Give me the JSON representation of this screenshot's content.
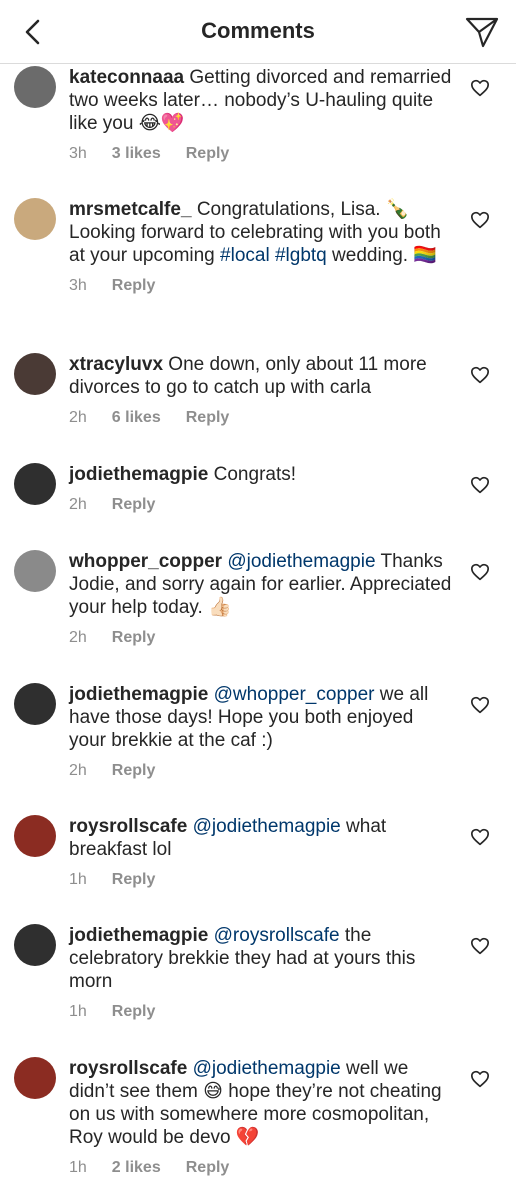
{
  "header": {
    "title": "Comments"
  },
  "colors": {
    "text": "#262626",
    "meta": "#8e8e8e",
    "link": "#00376b",
    "divider": "#dbdbdb"
  },
  "comments": [
    {
      "username": "kateconnaaa",
      "parts": [
        {
          "t": "text",
          "v": "Getting divorced and remarried two weeks later… nobody’s U-hauling quite like you 😂💖"
        }
      ],
      "time": "3h",
      "likes": "3 likes",
      "reply": "Reply",
      "avatar_color": "#6b6b6b"
    },
    {
      "username": "mrsmetcalfe_",
      "parts": [
        {
          "t": "text",
          "v": "Congratulations, Lisa. 🍾 Looking forward to celebrating with you both at your upcoming "
        },
        {
          "t": "tag",
          "v": "#local"
        },
        {
          "t": "text",
          "v": " "
        },
        {
          "t": "tag",
          "v": "#lgbtq"
        },
        {
          "t": "text",
          "v": " wedding. 🏳️‍🌈"
        }
      ],
      "time": "3h",
      "likes": "",
      "reply": "Reply",
      "avatar_color": "#c9a97d"
    },
    {
      "username": "xtracyluvx",
      "parts": [
        {
          "t": "text",
          "v": "One down, only about 11 more divorces to go to catch up with carla"
        }
      ],
      "time": "2h",
      "likes": "6 likes",
      "reply": "Reply",
      "avatar_color": "#4a3a35"
    },
    {
      "username": "jodiethemagpie",
      "parts": [
        {
          "t": "text",
          "v": "Congrats!"
        }
      ],
      "time": "2h",
      "likes": "",
      "reply": "Reply",
      "avatar_color": "#2f2f2f"
    },
    {
      "username": "whopper_copper",
      "parts": [
        {
          "t": "mention",
          "v": "@jodiethemagpie"
        },
        {
          "t": "text",
          "v": " Thanks Jodie, and sorry again for earlier. Appreciated your help today. 👍🏻"
        }
      ],
      "time": "2h",
      "likes": "",
      "reply": "Reply",
      "avatar_color": "#8a8a8a"
    },
    {
      "username": "jodiethemagpie",
      "parts": [
        {
          "t": "mention",
          "v": "@whopper_copper"
        },
        {
          "t": "text",
          "v": " we all have those days! Hope you both enjoyed your brekkie at the caf :)"
        }
      ],
      "time": "2h",
      "likes": "",
      "reply": "Reply",
      "avatar_color": "#2f2f2f"
    },
    {
      "username": "roysrollscafe",
      "parts": [
        {
          "t": "mention",
          "v": "@jodiethemagpie"
        },
        {
          "t": "text",
          "v": " what breakfast lol"
        }
      ],
      "time": "1h",
      "likes": "",
      "reply": "Reply",
      "avatar_color": "#8b2c22"
    },
    {
      "username": "jodiethemagpie",
      "parts": [
        {
          "t": "mention",
          "v": "@roysrollscafe"
        },
        {
          "t": "text",
          "v": " the celebratory brekkie they had at yours this morn"
        }
      ],
      "time": "1h",
      "likes": "",
      "reply": "Reply",
      "avatar_color": "#2f2f2f"
    },
    {
      "username": "roysrollscafe",
      "parts": [
        {
          "t": "mention",
          "v": "@jodiethemagpie"
        },
        {
          "t": "text",
          "v": " well we didn’t see them 😅 hope they’re not cheating on us with somewhere more cosmopolitan, Roy would be devo 💔"
        }
      ],
      "time": "1h",
      "likes": "2 likes",
      "reply": "Reply",
      "avatar_color": "#8b2c22"
    }
  ]
}
